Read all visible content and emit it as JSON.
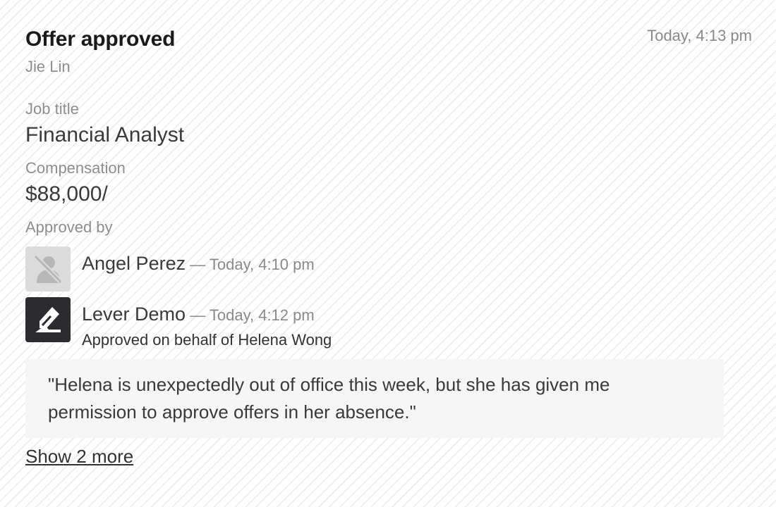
{
  "card": {
    "title": "Offer approved",
    "timestamp": "Today, 4:13 pm",
    "candidate": "Jie Lin"
  },
  "fields": {
    "job_title_label": "Job title",
    "job_title_value": "Financial Analyst",
    "compensation_label": "Compensation",
    "compensation_value": "$88,000/",
    "approved_by_label": "Approved by"
  },
  "approvers": [
    {
      "name": "Angel Perez",
      "meta": " — Today, 4:10 pm",
      "avatar_icon": "no-photo-icon"
    },
    {
      "name": "Lever Demo",
      "meta": " — Today, 4:12 pm",
      "avatar_icon": "lever-logo-icon",
      "behalf": "Approved on behalf of Helena Wong",
      "note": "\"Helena is unexpectedly out of office this week, but she has given me permission to approve offers in her absence.\""
    }
  ],
  "show_more": "Show 2 more"
}
